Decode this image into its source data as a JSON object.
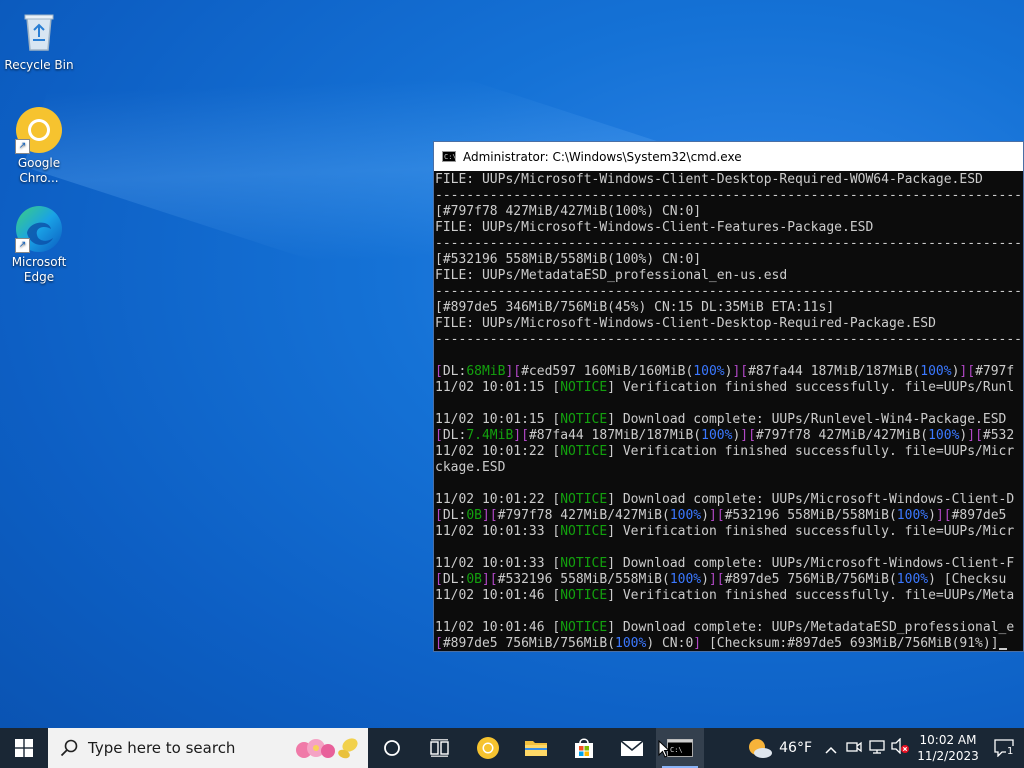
{
  "desktop": {
    "icons": [
      {
        "label": "Recycle Bin",
        "icon": "recycle-bin-icon"
      },
      {
        "label": "Google Chro...",
        "icon": "chrome-icon"
      },
      {
        "label": "Microsoft Edge",
        "icon": "edge-icon"
      }
    ]
  },
  "cmd": {
    "title": "Administrator: C:\\Windows\\System32\\cmd.exe",
    "lines": [
      [
        {
          "t": "FILE: UUPs/Microsoft-Windows-Client-Desktop-Required-WOW64-Package.ESD"
        }
      ],
      [
        {
          "t": "-------------------------------------------------------------------------------"
        }
      ],
      [
        {
          "t": "[#797f78 427MiB/427MiB(100%) CN:0]"
        }
      ],
      [
        {
          "t": "FILE: UUPs/Microsoft-Windows-Client-Features-Package.ESD"
        }
      ],
      [
        {
          "t": "-------------------------------------------------------------------------------"
        }
      ],
      [
        {
          "t": "[#532196 558MiB/558MiB(100%) CN:0]"
        }
      ],
      [
        {
          "t": "FILE: UUPs/MetadataESD_professional_en-us.esd"
        }
      ],
      [
        {
          "t": "-------------------------------------------------------------------------------"
        }
      ],
      [
        {
          "t": "[#897de5 346MiB/756MiB(45%) CN:15 DL:35MiB ETA:11s]"
        }
      ],
      [
        {
          "t": "FILE: UUPs/Microsoft-Windows-Client-Desktop-Required-Package.ESD"
        }
      ],
      [
        {
          "t": "-------------------------------------------------------------------------------"
        }
      ],
      [
        {
          "t": ""
        }
      ],
      [
        {
          "t": "[",
          "c": "m"
        },
        {
          "t": "DL:"
        },
        {
          "t": "68MiB",
          "c": "g"
        },
        {
          "t": "][",
          "c": "m"
        },
        {
          "t": "#ced597 160MiB/160MiB("
        },
        {
          "t": "100%",
          "c": "b"
        },
        {
          "t": ")"
        },
        {
          "t": "][",
          "c": "m"
        },
        {
          "t": "#87fa44 187MiB/187MiB("
        },
        {
          "t": "100%",
          "c": "b"
        },
        {
          "t": ")"
        },
        {
          "t": "][",
          "c": "m"
        },
        {
          "t": "#797f"
        }
      ],
      [
        {
          "t": "11/02 10:01:15 ["
        },
        {
          "t": "NOTICE",
          "c": "g"
        },
        {
          "t": "] Verification finished successfully. file=UUPs/Runl"
        }
      ],
      [
        {
          "t": ""
        }
      ],
      [
        {
          "t": "11/02 10:01:15 ["
        },
        {
          "t": "NOTICE",
          "c": "g"
        },
        {
          "t": "] Download complete: UUPs/Runlevel-Win4-Package.ESD"
        }
      ],
      [
        {
          "t": "[",
          "c": "m"
        },
        {
          "t": "DL:"
        },
        {
          "t": "7.4MiB",
          "c": "g"
        },
        {
          "t": "][",
          "c": "m"
        },
        {
          "t": "#87fa44 187MiB/187MiB("
        },
        {
          "t": "100%",
          "c": "b"
        },
        {
          "t": ")"
        },
        {
          "t": "][",
          "c": "m"
        },
        {
          "t": "#797f78 427MiB/427MiB("
        },
        {
          "t": "100%",
          "c": "b"
        },
        {
          "t": ")"
        },
        {
          "t": "][",
          "c": "m"
        },
        {
          "t": "#532"
        }
      ],
      [
        {
          "t": "11/02 10:01:22 ["
        },
        {
          "t": "NOTICE",
          "c": "g"
        },
        {
          "t": "] Verification finished successfully. file=UUPs/Micr"
        }
      ],
      [
        {
          "t": "ckage.ESD"
        }
      ],
      [
        {
          "t": ""
        }
      ],
      [
        {
          "t": "11/02 10:01:22 ["
        },
        {
          "t": "NOTICE",
          "c": "g"
        },
        {
          "t": "] Download complete: UUPs/Microsoft-Windows-Client-D"
        }
      ],
      [
        {
          "t": "[",
          "c": "m"
        },
        {
          "t": "DL:"
        },
        {
          "t": "0B",
          "c": "g"
        },
        {
          "t": "][",
          "c": "m"
        },
        {
          "t": "#797f78 427MiB/427MiB("
        },
        {
          "t": "100%",
          "c": "b"
        },
        {
          "t": ")"
        },
        {
          "t": "][",
          "c": "m"
        },
        {
          "t": "#532196 558MiB/558MiB("
        },
        {
          "t": "100%",
          "c": "b"
        },
        {
          "t": ")"
        },
        {
          "t": "][",
          "c": "m"
        },
        {
          "t": "#897de5"
        }
      ],
      [
        {
          "t": "11/02 10:01:33 ["
        },
        {
          "t": "NOTICE",
          "c": "g"
        },
        {
          "t": "] Verification finished successfully. file=UUPs/Micr"
        }
      ],
      [
        {
          "t": ""
        }
      ],
      [
        {
          "t": "11/02 10:01:33 ["
        },
        {
          "t": "NOTICE",
          "c": "g"
        },
        {
          "t": "] Download complete: UUPs/Microsoft-Windows-Client-F"
        }
      ],
      [
        {
          "t": "[",
          "c": "m"
        },
        {
          "t": "DL:"
        },
        {
          "t": "0B",
          "c": "g"
        },
        {
          "t": "][",
          "c": "m"
        },
        {
          "t": "#532196 558MiB/558MiB("
        },
        {
          "t": "100%",
          "c": "b"
        },
        {
          "t": ")"
        },
        {
          "t": "][",
          "c": "m"
        },
        {
          "t": "#897de5 756MiB/756MiB("
        },
        {
          "t": "100%",
          "c": "b"
        },
        {
          "t": ") [Checksu"
        }
      ],
      [
        {
          "t": "11/02 10:01:46 ["
        },
        {
          "t": "NOTICE",
          "c": "g"
        },
        {
          "t": "] Verification finished successfully. file=UUPs/Meta"
        }
      ],
      [
        {
          "t": ""
        }
      ],
      [
        {
          "t": "11/02 10:01:46 ["
        },
        {
          "t": "NOTICE",
          "c": "g"
        },
        {
          "t": "] Download complete: UUPs/MetadataESD_professional_e"
        }
      ],
      [
        {
          "t": "[",
          "c": "m"
        },
        {
          "t": "#897de5 756MiB/756MiB("
        },
        {
          "t": "100%",
          "c": "b"
        },
        {
          "t": ") CN:0"
        },
        {
          "t": "]",
          "c": "m"
        },
        {
          "t": " [Checksum:#897de5 693MiB/756MiB(91%)]"
        }
      ]
    ]
  },
  "taskbar": {
    "search_placeholder": "Type here to search",
    "weather": "46°F",
    "time": "10:02 AM",
    "date": "11/2/2023",
    "notifications": "1"
  }
}
